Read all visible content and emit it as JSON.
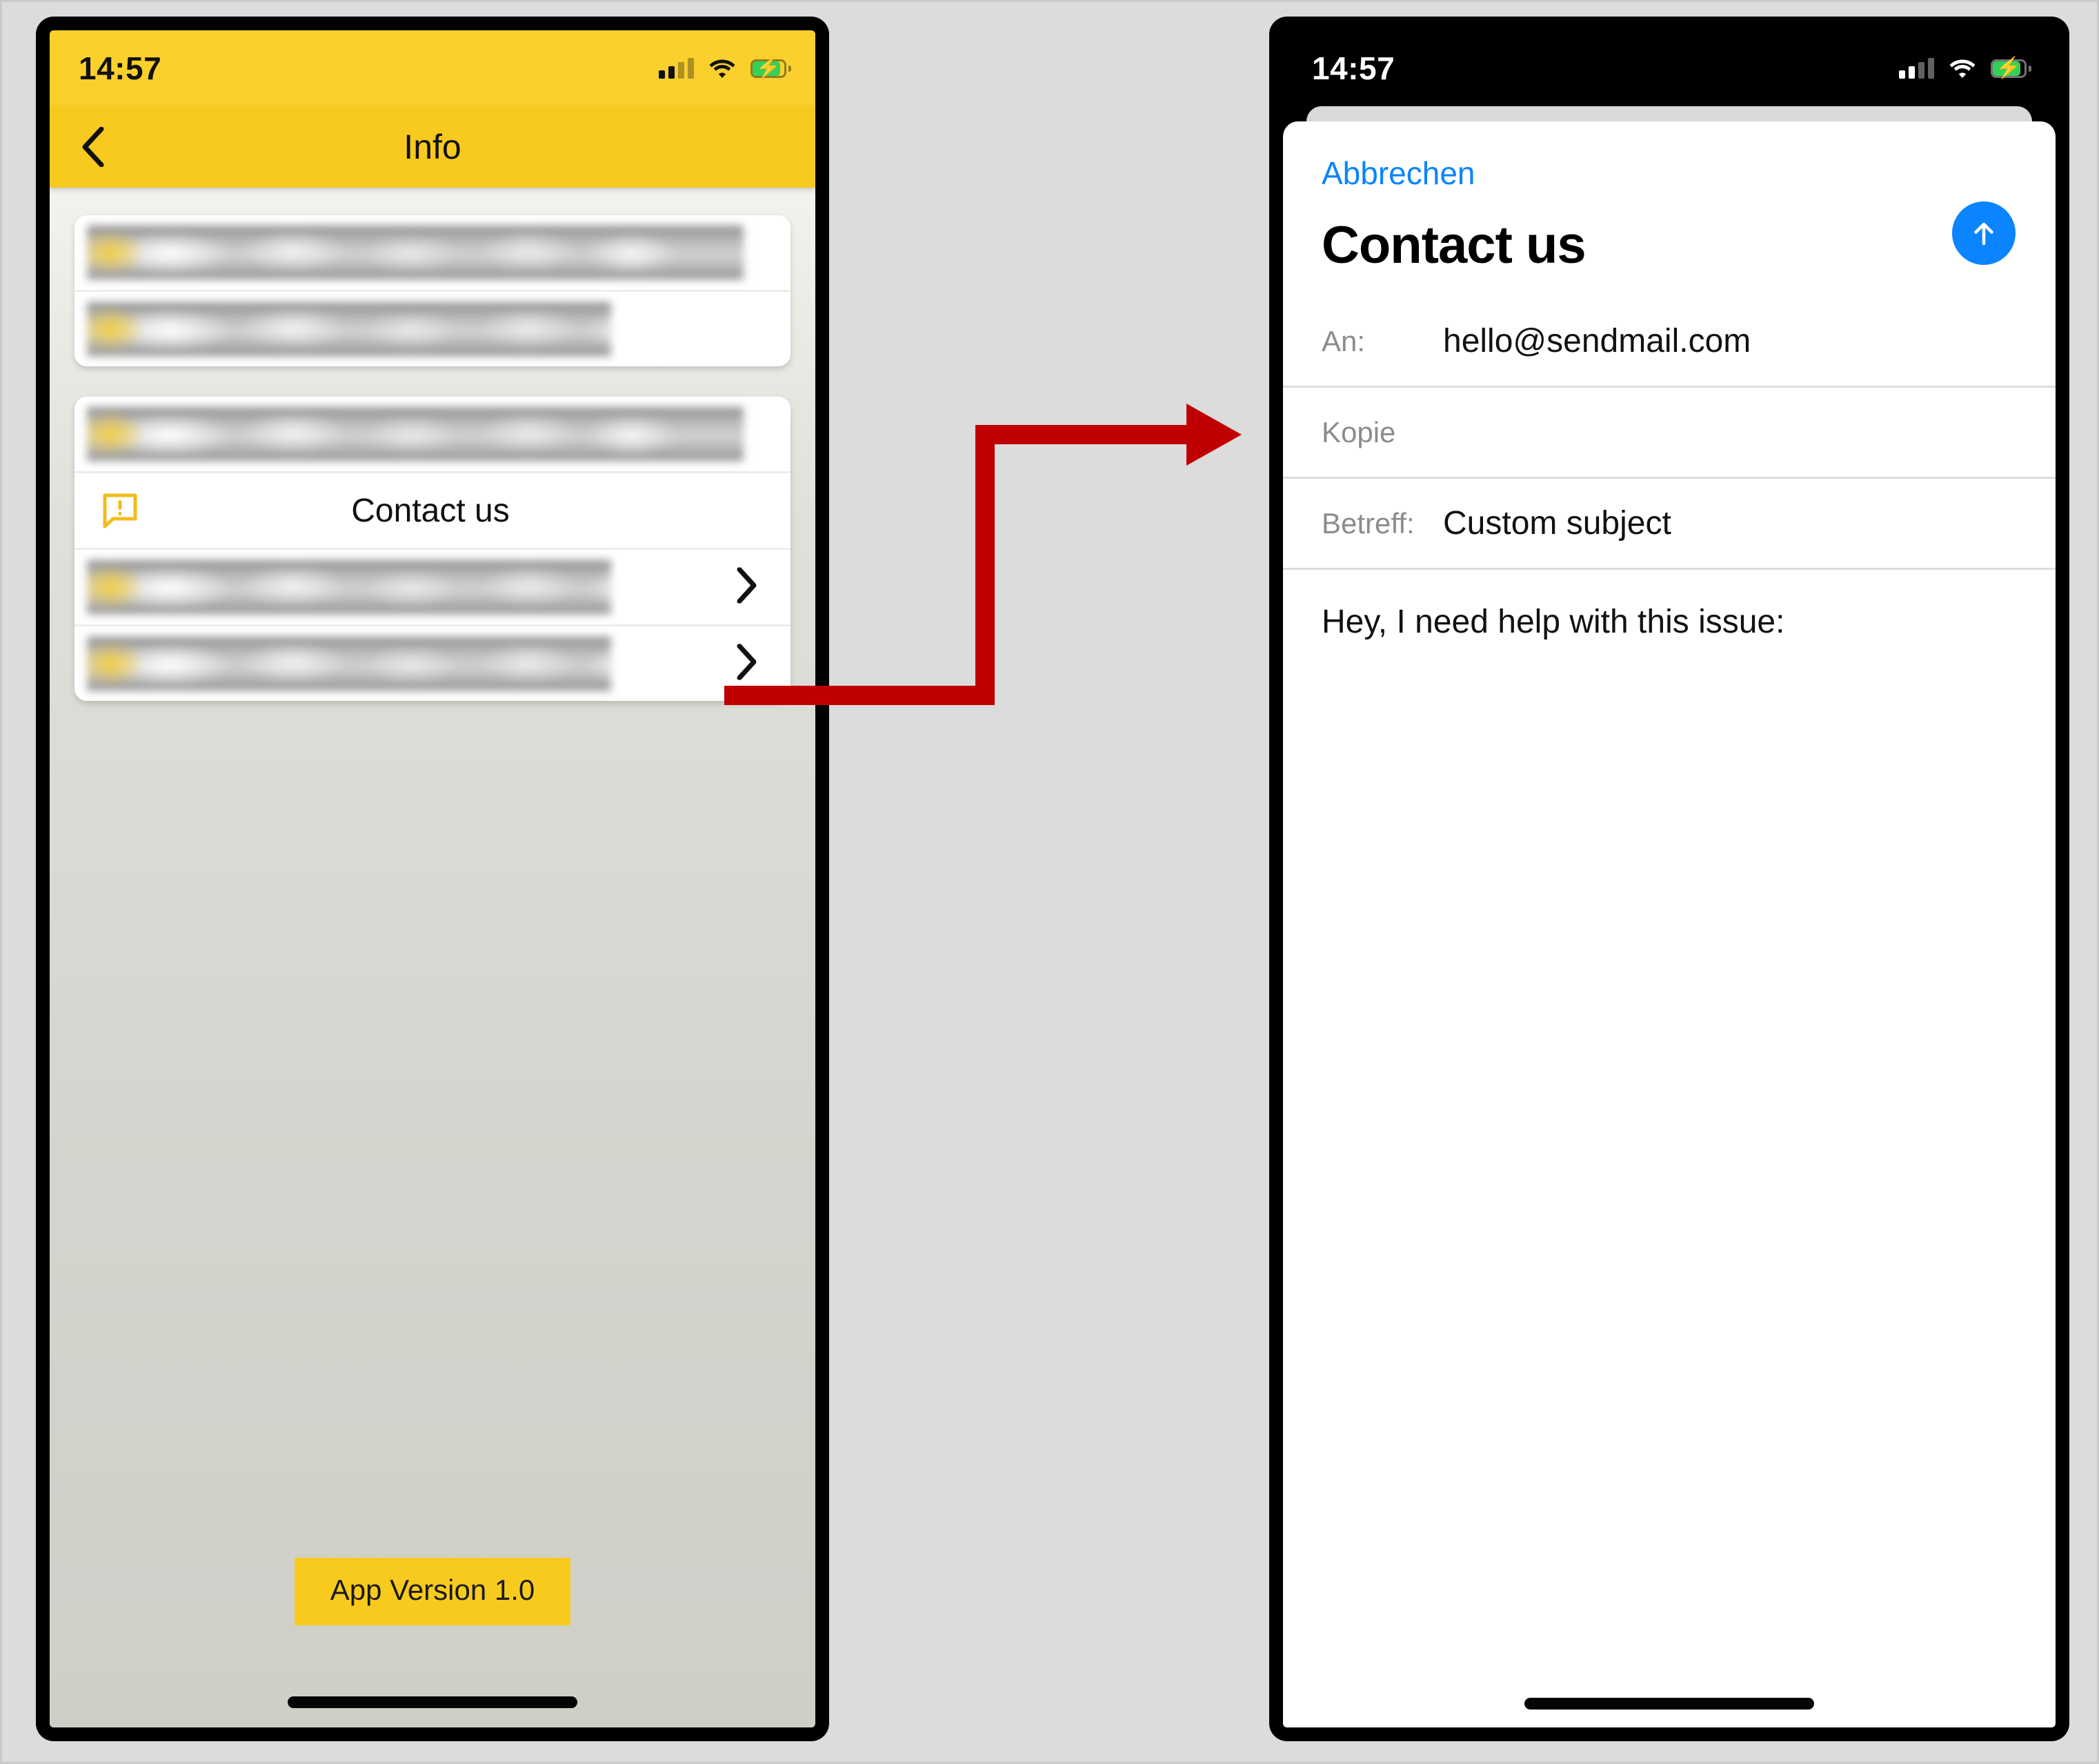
{
  "colors": {
    "brand_yellow": "#f8c91f",
    "statusbar_yellow": "#fbd02d",
    "arrow_red": "#c00000",
    "ios_blue": "#0b84ff",
    "battery_green": "#33d158",
    "page_background": "#dcdcdc"
  },
  "left_phone": {
    "status_bar": {
      "time": "14:57",
      "signal_icon": "cellular-signal-icon",
      "wifi_icon": "wifi-icon",
      "battery_icon": "battery-charging-icon"
    },
    "nav_bar": {
      "back_icon": "chevron-left-icon",
      "title": "Info"
    },
    "groups": [
      {
        "rows": [
          {
            "type": "redacted",
            "label": "",
            "width": "full",
            "chevron": false
          },
          {
            "type": "redacted",
            "label": "",
            "width": "short",
            "chevron": false
          }
        ]
      },
      {
        "rows": [
          {
            "type": "redacted",
            "label": "",
            "width": "full",
            "chevron": false
          },
          {
            "type": "contact",
            "label": "Contact us",
            "icon": "speech-bubble-alert-icon",
            "chevron": false
          },
          {
            "type": "redacted",
            "label": "",
            "width": "short",
            "chevron": true
          },
          {
            "type": "redacted",
            "label": "",
            "width": "short",
            "chevron": true
          }
        ]
      }
    ],
    "version_button": "App Version 1.0",
    "home_indicator": "home-indicator"
  },
  "right_phone": {
    "status_bar": {
      "time": "14:57",
      "signal_icon": "cellular-signal-icon",
      "wifi_icon": "wifi-icon",
      "battery_icon": "battery-charging-icon"
    },
    "compose_sheet": {
      "cancel_label": "Abbrechen",
      "title": "Contact us",
      "send_icon": "arrow-up-circle-icon",
      "fields": [
        {
          "label": "An:",
          "value": "hello@sendmail.com",
          "is_placeholder": false
        },
        {
          "label": "Kopie",
          "value": "",
          "is_placeholder": true
        },
        {
          "label": "Betreff:",
          "value": "Custom subject",
          "is_placeholder": false
        }
      ],
      "body": "Hey, I need help with this issue:"
    },
    "home_indicator": "home-indicator"
  },
  "annotation": {
    "arrow_icon": "red-connector-arrow",
    "from": "Contact us",
    "to": "Contact us"
  }
}
